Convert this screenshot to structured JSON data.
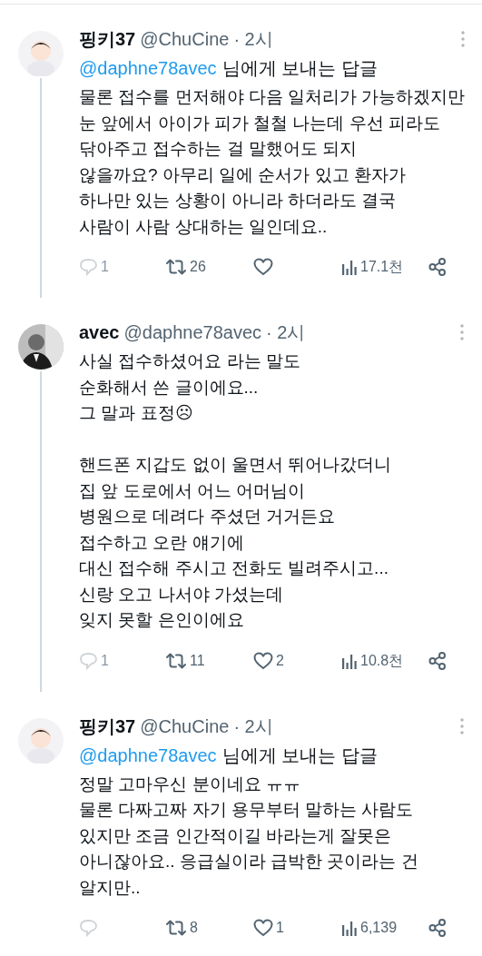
{
  "tweets": [
    {
      "name": "핑키37",
      "handle": "@ChuCine",
      "time": "· 2시",
      "reply_to": {
        "mention": "@daphne78avec",
        "suffix": "님에게 보내는 답글"
      },
      "thread_line": true,
      "paragraphs": [
        [
          "물론 접수를 먼저해야 다음 일처리가 가능하겠지만",
          "눈 앞에서 아이가 피가 철철 나는데 우선 피라도",
          "닦아주고 접수하는 걸 말했어도 되지",
          "않을까요? 아무리 일에 순서가 있고 환자가",
          "하나만 있는 상황이 아니라 하더라도 결국",
          "사람이 사람 상대하는 일인데요.."
        ]
      ],
      "stats": {
        "replies": "1",
        "retweets": "26",
        "views": "17.1천"
      }
    },
    {
      "name": "avec",
      "handle": "@daphne78avec",
      "time": "· 2시",
      "thread_line": true,
      "paragraphs": [
        [
          "사실 접수하셨어요 라는 말도",
          "순화해서 쓴 글이에요...",
          "그 말과 표정☹"
        ],
        [
          "핸드폰 지갑도 없이 울면서 뛰어나갔더니",
          "집 앞 도로에서 어느 어머님이",
          "병원으로 데려다 주셨던 거거든요",
          "접수하고 오란 얘기에",
          "대신 접수해 주시고 전화도 빌려주시고...",
          "신랑 오고 나서야 가셨는데",
          "잊지 못할 은인이에요"
        ]
      ],
      "stats": {
        "replies": "1",
        "retweets": "11",
        "likes": "2",
        "views": "10.8천"
      }
    },
    {
      "name": "핑키37",
      "handle": "@ChuCine",
      "time": "· 2시",
      "reply_to": {
        "mention": "@daphne78avec",
        "suffix": "님에게 보내는 답글"
      },
      "thread_line": false,
      "paragraphs": [
        [
          "정말 고마우신 분이네요 ㅠㅠ",
          "물론 다짜고짜 자기 용무부터 말하는 사람도",
          "있지만 조금 인간적이길 바라는게 잘못은",
          "아니잖아요.. 응급실이라 급박한 곳이라는 건",
          "알지만.."
        ]
      ],
      "stats": {
        "retweets": "8",
        "likes": "1",
        "views": "6,139"
      }
    }
  ]
}
